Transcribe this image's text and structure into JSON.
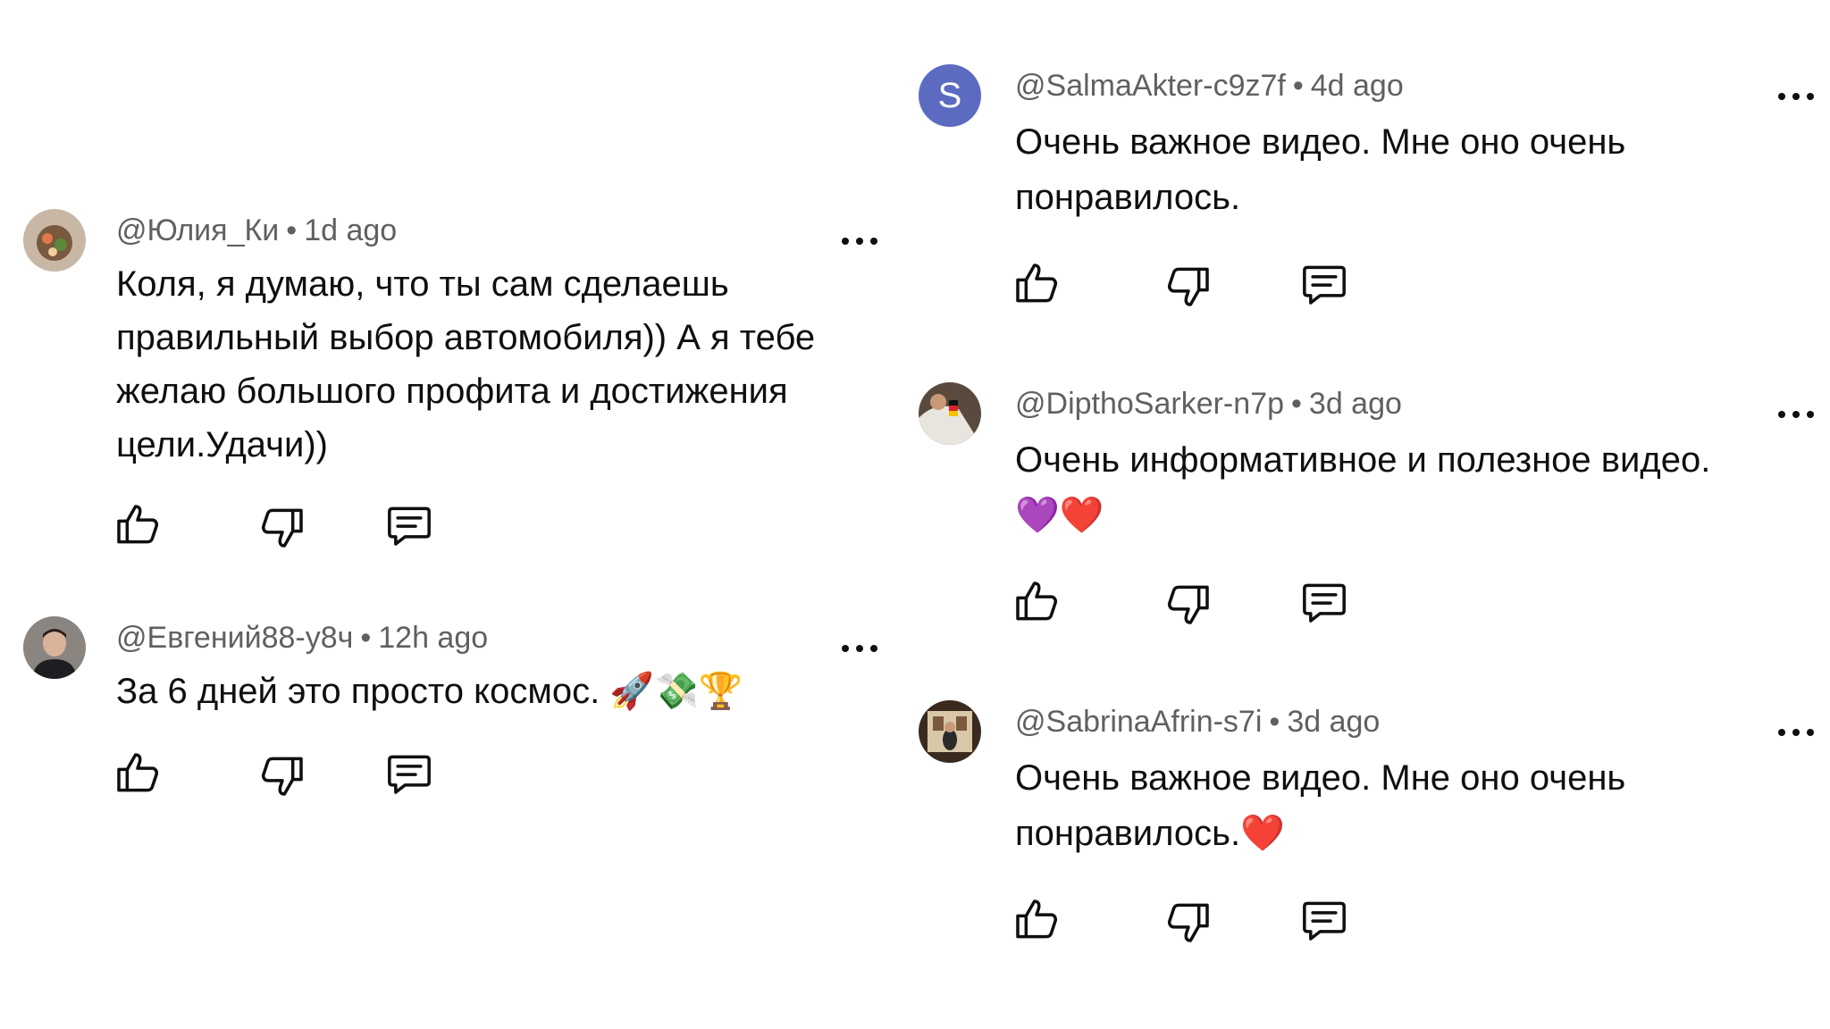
{
  "comments": [
    {
      "author": "@Юлия_Ки",
      "separator": "•",
      "time": "1d ago",
      "lines": [
        "Коля, я думаю, что ты сам сделаешь",
        "правильный выбор автомобиля)) А я тебе",
        "желаю большого профита и достижения",
        "цели.Удачи))"
      ]
    },
    {
      "author": "@Евгений88-у8ч",
      "separator": "•",
      "time": "12h ago",
      "lines": [
        "За 6 дней это просто космос. 🚀💸🏆"
      ]
    },
    {
      "author": "@SalmaAkter-c9z7f",
      "separator": "•",
      "time": "4d ago",
      "avatar_initial": "S",
      "avatar_color": "#5c6bc0",
      "lines": [
        "Очень важное видео. Мне оно очень",
        "понравилось."
      ]
    },
    {
      "author": "@DipthoSarker-n7p",
      "separator": "•",
      "time": "3d ago",
      "lines": [
        "Очень информативное и полезное видео.",
        "💜❤️"
      ]
    },
    {
      "author": "@SabrinaAfrin-s7i",
      "separator": "•",
      "time": "3d ago",
      "lines": [
        "Очень важное видео. Мне оно очень",
        "понравилось.❤️"
      ]
    }
  ],
  "icons": {
    "like": "thumb-up-icon",
    "dislike": "thumb-down-icon",
    "reply": "reply-icon",
    "more": "more-options-icon"
  }
}
